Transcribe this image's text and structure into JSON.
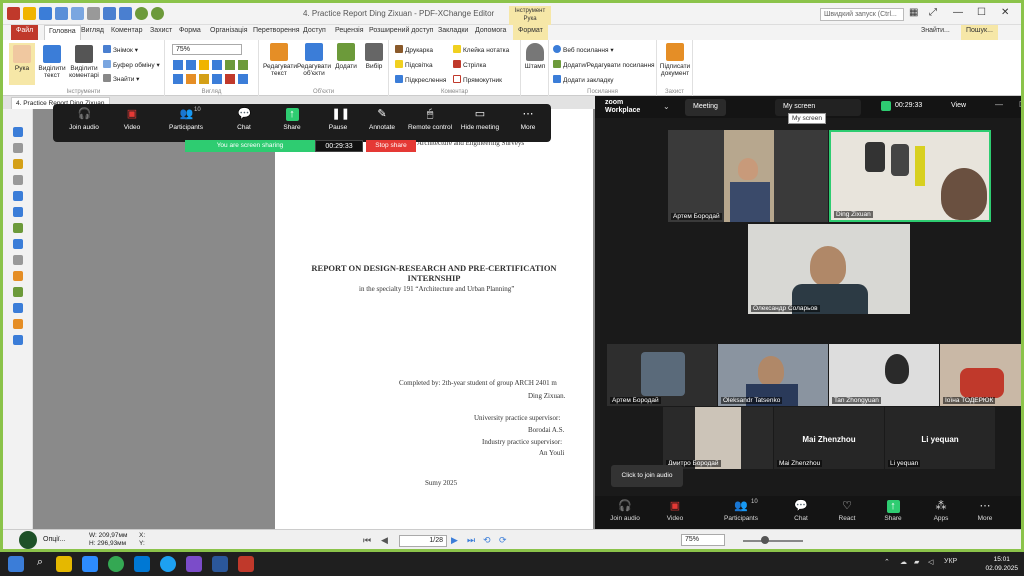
{
  "pdf_editor": {
    "title": "4. Practice Report Ding Zixuan - PDF-XChange Editor",
    "tool_tab": "Інструмент Рука",
    "search_placeholder": "Швидкий запуск (Ctrl...",
    "ribbon_tabs": [
      "Файл",
      "Головна",
      "Вигляд",
      "Коментар",
      "Захист",
      "Форма",
      "Організація",
      "Перетворення",
      "Доступ",
      "Рецензія",
      "Розширений доступ",
      "Закладки",
      "Допомога",
      "Формат"
    ],
    "find_label": "Знайти...",
    "search_label": "Пошук...",
    "zoom": "75%",
    "groups": {
      "tools": "Інструменти",
      "view": "Вигляд",
      "objects": "Об'єкти",
      "comment": "Коментар",
      "links": "Посилання",
      "protect": "Захист"
    },
    "buttons": {
      "hand": "Рука",
      "select_text": "Виділити текст",
      "select_comments": "Виділити коментарі",
      "snapshot": "Знімок",
      "clipboard": "Буфер обміну",
      "find": "Знайти",
      "edit_text": "Редагувати текст",
      "edit_objects": "Редагувати об'єкти",
      "add": "Додати",
      "select": "Вибір",
      "typewriter": "Друкарка",
      "sticky_note": "Клейка нотатка",
      "highlight": "Підсвітка",
      "arrow": "Стрілка",
      "underline": "Підкреслення",
      "rectangle": "Прямокутник",
      "stamp": "Штамп",
      "web_links": "Веб посилання",
      "add_edit_links": "Додати/Редагувати посилання",
      "add_bookmark": "Додати закладку",
      "sign_document": "Підписати документ"
    },
    "doc_tab": "4. Practice Report Ding Zixuan",
    "page_indicator": "1/28",
    "zoom_status": "75%",
    "dimensions": "W: 209,97мм\nH: 296,93мм",
    "options_label": "Опції..."
  },
  "document": {
    "header_line": "Architecture and Engineering Surveys",
    "title_line1": "REPORT ON DESIGN-RESEARCH AND PRE-CERTIFICATION",
    "title_line2": "INTERNSHIP",
    "subtitle": "in the specialty 191 “Architecture and Urban Planning”",
    "completed_by": "Completed by: 2th-year student of group ARCH 2401 m",
    "student": "Ding Zixuan.",
    "uni_supervisor_label": "University practice supervisor:",
    "uni_supervisor": "Borodai A.S.",
    "industry_supervisor_label": "Industry practice supervisor:",
    "industry_supervisor": "An Youli",
    "city_year": "Sumy 2025"
  },
  "zoom_toolbar": {
    "buttons": [
      "Join audio",
      "Video",
      "Participants",
      "Chat",
      "Share",
      "Pause",
      "Annotate",
      "Remote control",
      "Hide meeting",
      "More"
    ],
    "participant_count": "10",
    "sharing_banner": "You are screen sharing",
    "timer": "00:29:33",
    "stop_share": "Stop share"
  },
  "zoom_window": {
    "logo_line1": "zoom",
    "logo_line2": "Workplace",
    "tab_meeting": "Meeting",
    "tab_my_screen": "My screen",
    "tooltip": "My screen",
    "timer": "00:29:33",
    "view_label": "View",
    "participants": [
      "Артем Бородай",
      "Ding Zixuan",
      "Олександр Соларьов",
      "Артем Бородай",
      "Oleksandr Tatsenko",
      "Tan Zhongyuan",
      "Іоїна ТОДЕРЮК",
      "Дмитро Бородай",
      "Mai Zhenzhou",
      "Li yequan"
    ],
    "center_names": [
      "Mai Zhenzhou",
      "Li yequan"
    ],
    "click_to_join": "Click to join audio",
    "bottom_buttons": [
      "Join audio",
      "Video",
      "Participants",
      "Chat",
      "React",
      "Share",
      "Apps",
      "More"
    ],
    "participant_count": "10"
  },
  "taskbar": {
    "lang": "УКР",
    "time": "15:01",
    "date": "02.09.2025"
  },
  "colors": {
    "frame_green": "#8bc34a",
    "share_green": "#2ecc71",
    "stop_red": "#e53935",
    "file_red": "#c0392b"
  }
}
